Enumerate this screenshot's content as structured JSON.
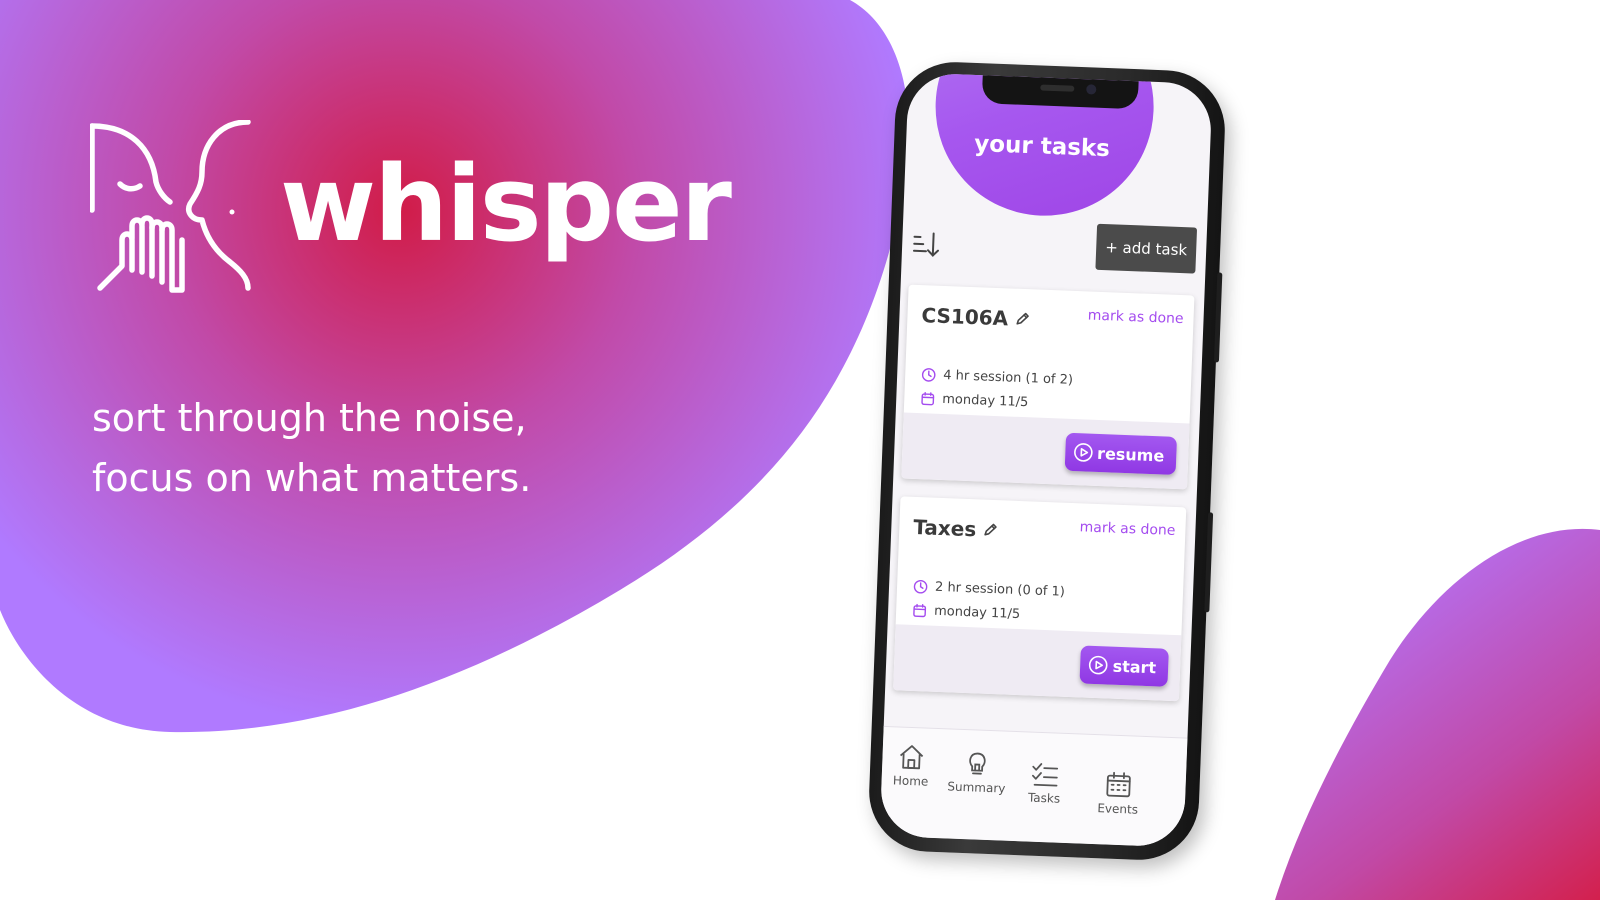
{
  "brand": {
    "name": "whisper",
    "logo_icon": "whisper-face-hand-icon",
    "tagline_line1": "sort through the noise,",
    "tagline_line2": "focus on what matters."
  },
  "colors": {
    "accent_purple": "#a44cef",
    "blob_red": "#d11c48",
    "blob_magenta": "#c14aa8",
    "blob_violet": "#b07aff",
    "add_button_bg": "#4b4b4b"
  },
  "app": {
    "header_title": "your tasks",
    "sort_icon": "sort-descending-icon",
    "add_task_label": "+ add task",
    "tasks": [
      {
        "title": "CS106A",
        "mark_done_label": "mark as done",
        "session": "4 hr session (1 of 2)",
        "date": "monday 11/5",
        "action_label": "resume"
      },
      {
        "title": "Taxes",
        "mark_done_label": "mark as done",
        "session": "2 hr session (0 of 1)",
        "date": "monday 11/5",
        "action_label": "start"
      }
    ],
    "tabbar": [
      {
        "label": "Home",
        "icon": "home-icon"
      },
      {
        "label": "Summary",
        "icon": "lightbulb-icon"
      },
      {
        "label": "Tasks",
        "icon": "checklist-icon"
      },
      {
        "label": "Events",
        "icon": "calendar-icon"
      }
    ]
  }
}
